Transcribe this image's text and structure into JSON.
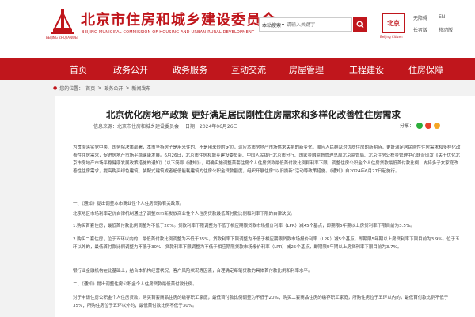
{
  "header": {
    "title": "北京市住房和城乡建设委员会",
    "subtitle": "BEIJING MUNICIPAL COMMISSION OF HOUSING AND URBAN-RURAL DEVELOPMENT",
    "logo_caption": "BEIJING ZHUJIANWEI",
    "badge_main": "北京",
    "badge_caption": "Beijing Citizen",
    "links": [
      "无障碍",
      "EN",
      "长者版",
      "移动版"
    ]
  },
  "search": {
    "scope": "本站搜索",
    "placeholder": "请输入关键字"
  },
  "nav": [
    "首页",
    "政务公开",
    "政务服务",
    "互动交流",
    "房屋管理",
    "工程建设",
    "住房保障"
  ],
  "breadcrumb": {
    "label": "您的位置：",
    "items": [
      "首页",
      "政务公开",
      "新闻发布"
    ],
    "sep": ">"
  },
  "article": {
    "title": "北京优化房地产政策 更好满足居民刚性住房需求和多样化改善性住房需求",
    "source": "信息来源：北京市住房和城乡建设委员会",
    "date": "日期：2024年06月26日",
    "share_label": "分享：",
    "paragraphs": [
      "为贯彻落实党中央、国务院决策部署，本市坚持房子是用来住的、不是用来炒的定位，适应本市房地产市场供求关系的新变化，顺应人民群众对优质住房的新期待，更好满足居民刚性住房需求和多样化改善性住房需求，促进房地产市场平稳健康发展。6月26日，北京市住房和城乡建设委员会、中国人民银行北京市分行、国家金融监督管理总局北京监管局、北京住房公积金管理中心联合印发《关于优化北京市房地产市场平稳健康发展政策措施的通知》（以下简称《通知》），明确实施调整首套住房个人住房贷款最低首付款比例和利率下限、调整住房公积金个人住房贷款最低首付款比例、支持多子女家庭改善性住房需求，提高购买绿色建筑、装配式建筑或者超低能耗建筑的住房公积金贷款额度，组织开展住房“以旧换新”活动等政策措施。《通知》自2024年6月27日起施行。",
      "一、《通知》提出调整本市商业性个人住房贷款有关政策。",
      "北京地区市场利率定价自律机制通过了调整本市新发放商业性个人住房贷款最低首付款比例和利率下限的自律决议。",
      "1.购买首套住房，最低首付款比例调整为不低于20%。贷款利率下限调整为不低于相应期限贷款市场报价利率（LPR）减45个基点，即期限5年期以上房贷利率下限目前为3.5%。",
      "2.购买二套住房，位于五环以内的，最低首付款比例调整为不低于35%，贷款利率下限调整为不低于相应期限贷款市场报价利率（LPR）减5个基点，即期限5年期以上房贷利率下限目前为3.9%。位于五环以外的，最低首付款比例调整为不低于30%，贷款利率下限调整为不低于相应期限贷款市场报价利率（LPR）减25个基点，即期限5年期以上房贷利率下限目前为3.7%。",
      "银行业金融机构在此基础上，结合本机构经营状况、客户风险状况等因素，合理确定每笔贷款的具体首付款比例和利率水平。",
      "二、《通知》提出调整住房公积金个人住房贷款最低首付款比例。",
      "对于申请住房公积金个人住房贷款，购买首套商品住房的缴存职工家庭，最低首付款比例调整为不低于20%；购买二套商品住房的缴存职工家庭，所购住房位于五环以内的，最低首付款比例不低于35%；所购住房位于五环以外的，最低首付款比例不低于30%。"
    ]
  },
  "colors": {
    "brand_red": "#c0161c",
    "share_wechat": "#2dae3c",
    "share_weibo": "#e8412c",
    "share_qzone": "#f5a623"
  }
}
